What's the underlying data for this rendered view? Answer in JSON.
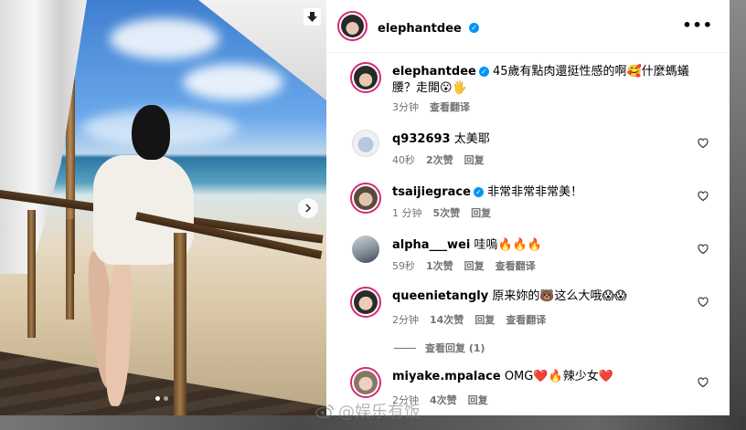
{
  "post": {
    "author": "elephantdee",
    "carousel": {
      "slide_count": 2,
      "active_slide": 1
    }
  },
  "caption": {
    "username": "elephantdee",
    "text": "45歲有點肉還挺性感的啊🥰什麼螞蟻腰？走開😮🖐",
    "time": "3分钟",
    "translate": "查看翻译"
  },
  "comments": [
    {
      "username": "q932693",
      "text": "太美耶",
      "time": "40秒",
      "likes": "2次赞",
      "reply": "回复",
      "translate": ""
    },
    {
      "username": "tsaijiegrace",
      "verified": true,
      "text": "非常非常非常美！",
      "time": "1 分钟",
      "likes": "5次赞",
      "reply": "回复",
      "translate": ""
    },
    {
      "username": "alpha___wei",
      "text": "哇嗚🔥🔥🔥",
      "time": "59秒",
      "likes": "1次赞",
      "reply": "回复",
      "translate": "查看翻译"
    },
    {
      "username": "queenietangly",
      "text": "原来妳的🐻这么大哦😱😱",
      "time": "2分钟",
      "likes": "14次赞",
      "reply": "回复",
      "translate": "查看翻译"
    },
    {
      "username": "miyake.mpalace",
      "text": "OMG❤️🔥辣少女❤️",
      "time": "2分钟",
      "likes": "4次赞",
      "reply": "回复",
      "translate": ""
    }
  ],
  "view_replies": "查看回复 (1)",
  "watermark": "@娱乐有饭",
  "colors": {
    "verified": "#0095f6",
    "story_ring": "#d62976",
    "meta_text": "#737373"
  },
  "icons": [
    "download-icon",
    "chevron-right-icon",
    "verified-icon",
    "more-icon",
    "heart-icon",
    "weibo-icon"
  ]
}
